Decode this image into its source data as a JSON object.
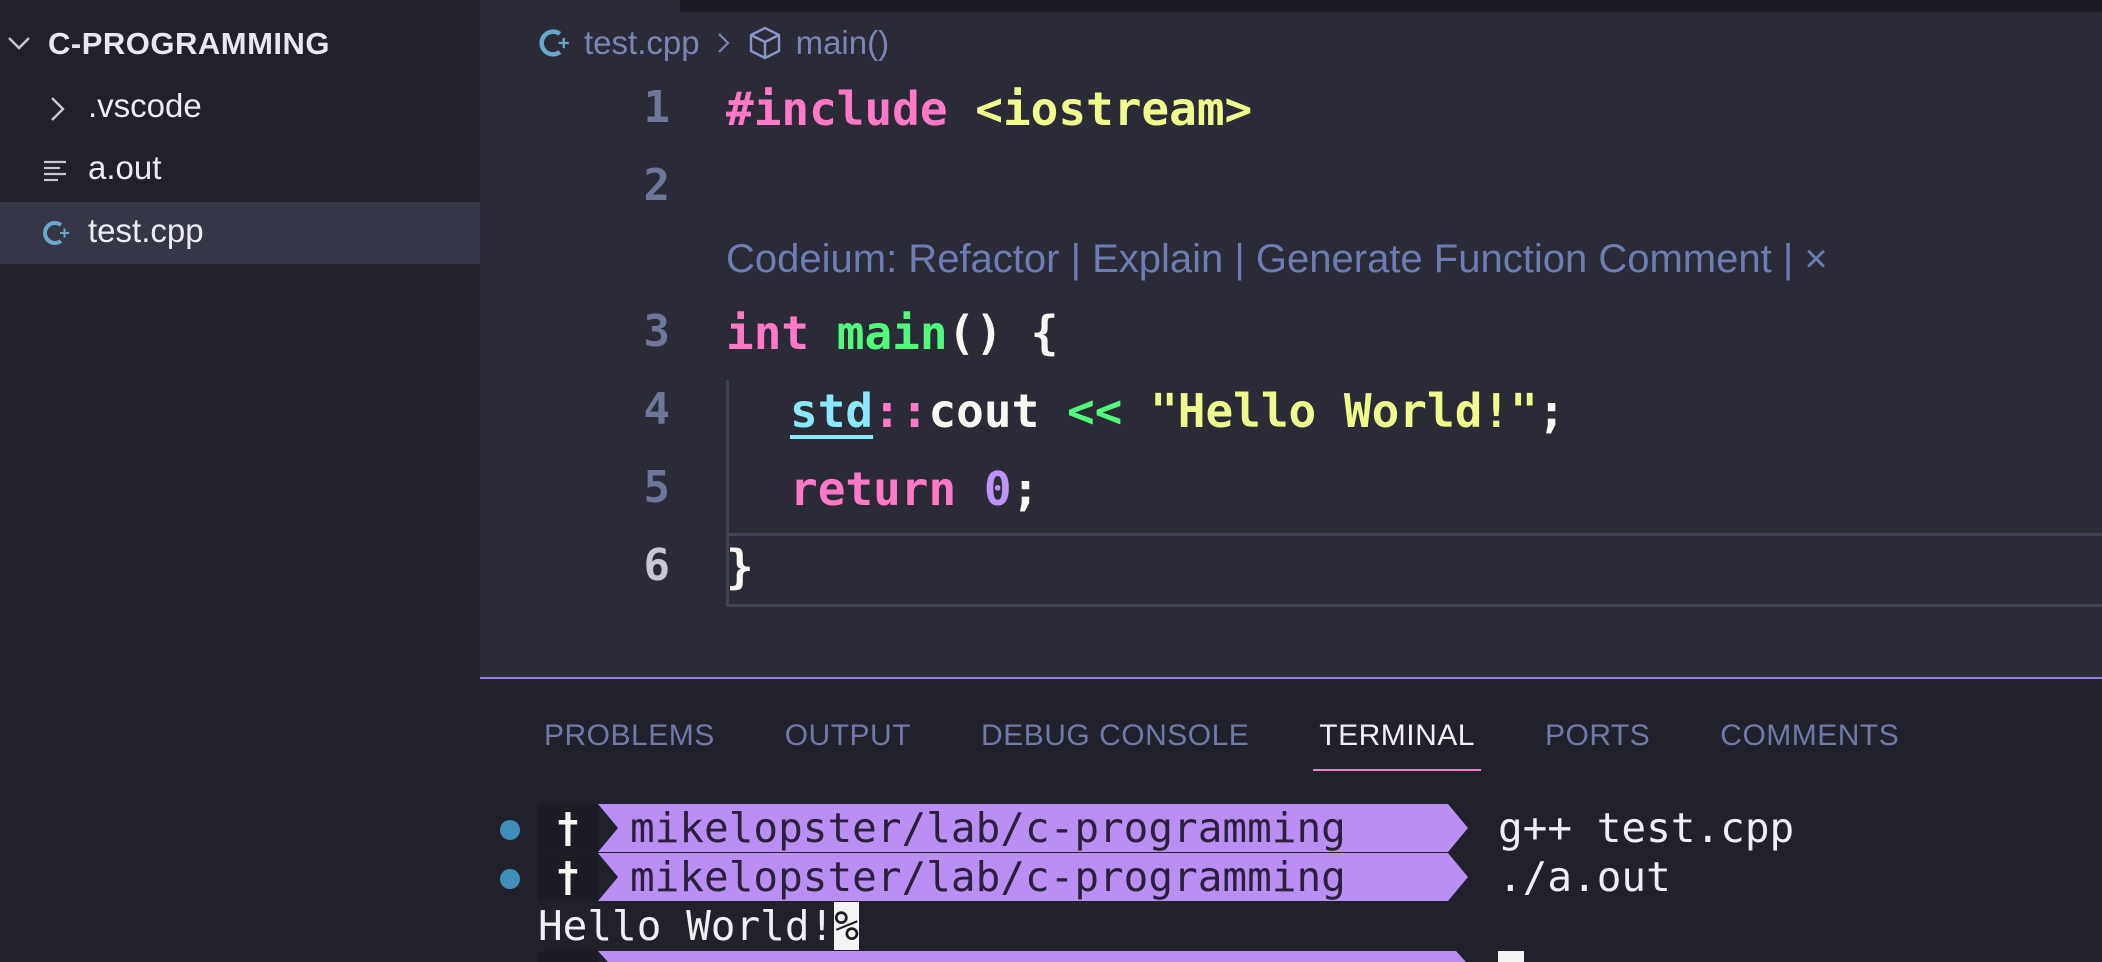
{
  "explorer": {
    "root_title": "C-PROGRAMMING",
    "items": [
      {
        "label": ".vscode",
        "icon": "chevron-right-icon"
      },
      {
        "label": "a.out",
        "icon": "lines-file-icon"
      },
      {
        "label": "test.cpp",
        "icon": "cpp-file-icon",
        "selected": true
      }
    ]
  },
  "breadcrumb": {
    "file": "test.cpp",
    "symbol": "main()",
    "separator": ">"
  },
  "editor": {
    "line_numbers": [
      "1",
      "2",
      "3",
      "4",
      "5",
      "6"
    ],
    "codelens": "Codeium: Refactor | Explain | Generate Function Comment | ×",
    "code": {
      "l1_a": "#include",
      "l1_b": "<iostream>",
      "l3_a": "int",
      "l3_b": "main",
      "l3_c": "() {",
      "l4_a": "std",
      "l4_b": "::",
      "l4_c": "cout",
      "l4_d": "<<",
      "l4_e": "\"Hello World!\"",
      "l4_f": ";",
      "l5_a": "return",
      "l5_b": "0",
      "l5_c": ";",
      "l6_a": "}"
    }
  },
  "panel": {
    "tabs": [
      "PROBLEMS",
      "OUTPUT",
      "DEBUG CONSOLE",
      "TERMINAL",
      "PORTS",
      "COMMENTS"
    ],
    "active_tab": "TERMINAL",
    "terminal": {
      "prompt_symbol": "†",
      "lines": [
        {
          "path": "mikelopster/lab/c-programming",
          "command": "g++ test.cpp"
        },
        {
          "path": "mikelopster/lab/c-programming",
          "command": "./a.out"
        }
      ],
      "output": "Hello World!",
      "output_suffix": "%"
    }
  },
  "colors": {
    "accent_pink": "#ff79c6",
    "prompt_purple": "#b98ff4",
    "string_yellow": "#f1fa8c",
    "function_green": "#50fa7b",
    "status_dot_blue": "#3f8fb8"
  }
}
